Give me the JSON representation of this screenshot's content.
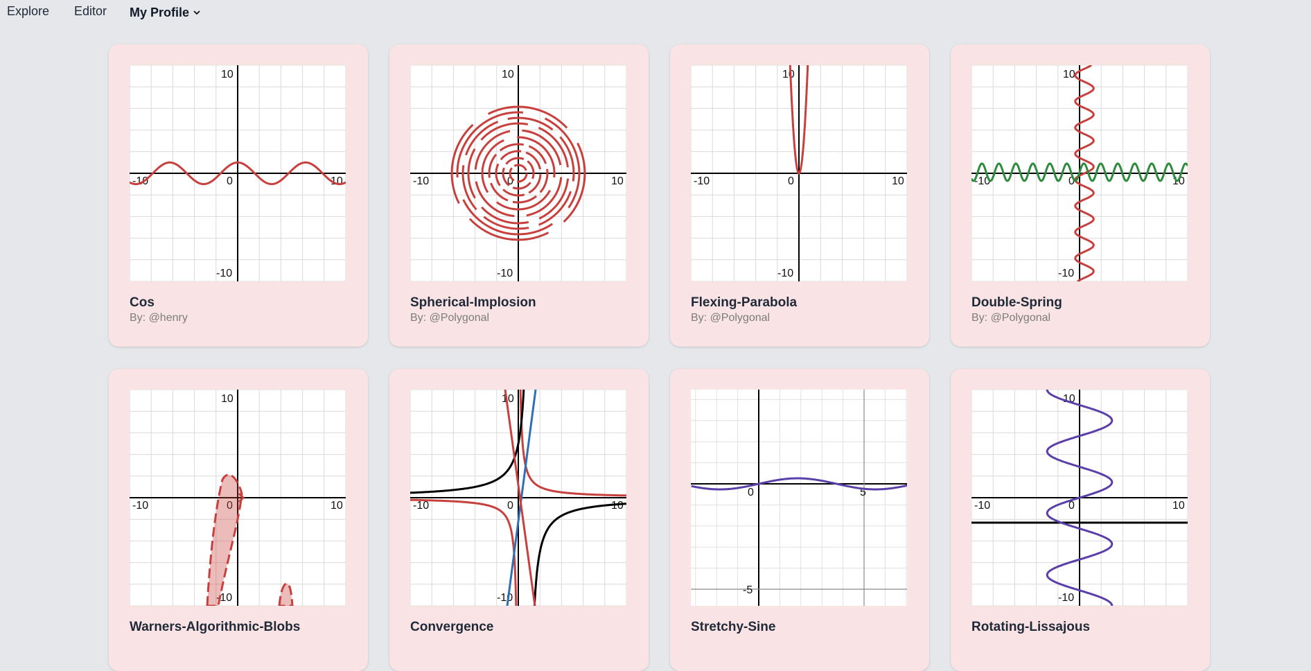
{
  "nav": {
    "explore": "Explore",
    "editor": "Editor",
    "profile": "My Profile",
    "profile_icon": "chevron-down-icon"
  },
  "cards": [
    {
      "title": "Cos",
      "author": "By: @henry",
      "ticks": [
        "10",
        "-10",
        "0",
        "10",
        "-10"
      ]
    },
    {
      "title": "Spherical-Implosion",
      "author": "By: @Polygonal",
      "ticks": [
        "10",
        "-10",
        "0",
        "10",
        "-10"
      ]
    },
    {
      "title": "Flexing-Parabola",
      "author": "By: @Polygonal",
      "ticks": [
        "10",
        "-10",
        "0",
        "10",
        "-10"
      ]
    },
    {
      "title": "Double-Spring",
      "author": "By: @Polygonal",
      "ticks": [
        "10",
        "-10",
        "0",
        "10",
        "-10"
      ]
    },
    {
      "title": "Warners-Algorithmic-Blobs",
      "author": "",
      "ticks": [
        "10",
        "-10",
        "0",
        "10",
        "-10"
      ]
    },
    {
      "title": "Convergence",
      "author": "",
      "ticks": [
        "10",
        "-10",
        "0",
        "10",
        "-10"
      ]
    },
    {
      "title": "Stretchy-Sine",
      "author": "",
      "ticks": [
        "0",
        "5",
        "-5"
      ]
    },
    {
      "title": "Rotating-Lissajous",
      "author": "",
      "ticks": [
        "10",
        "-10",
        "0",
        "10",
        "-10"
      ]
    }
  ],
  "colors": {
    "red": "#c8403d",
    "green": "#2e8b3d",
    "blue": "#2f6fb6",
    "purple": "#5b3fa8",
    "black": "#000000"
  }
}
